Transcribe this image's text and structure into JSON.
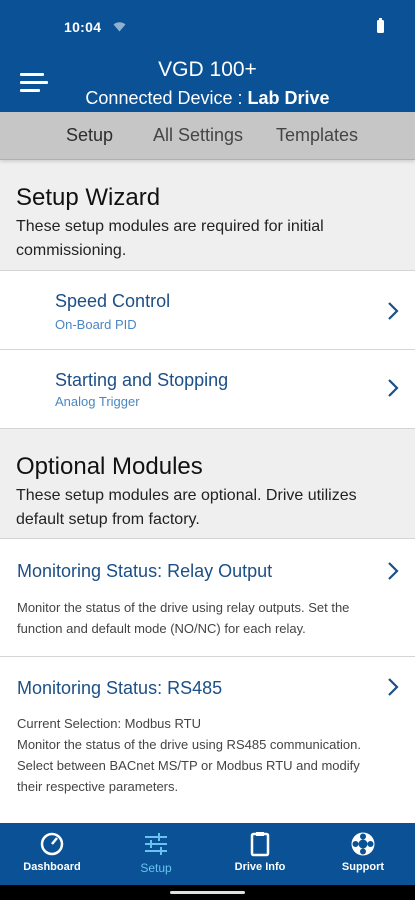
{
  "status": {
    "time": "10:04"
  },
  "header": {
    "title": "VGD 100+",
    "subtitle_prefix": "Connected Device :",
    "device_name": "Lab Drive"
  },
  "tabs": [
    {
      "label": "Setup",
      "active": true
    },
    {
      "label": "All Settings",
      "active": false
    },
    {
      "label": "Templates",
      "active": false
    }
  ],
  "setup_wizard": {
    "title": "Setup Wizard",
    "description": "These setup modules are required for initial commissioning.",
    "items": [
      {
        "title": "Speed Control",
        "subtitle": "On-Board PID"
      },
      {
        "title": "Starting and Stopping",
        "subtitle": "Analog Trigger"
      }
    ]
  },
  "optional_modules": {
    "title": "Optional Modules",
    "description": "These setup modules are optional.  Drive utilizes default setup from factory.",
    "items": [
      {
        "title": "Monitoring Status: Relay Output",
        "description": "Monitor the status of the drive using relay outputs.  Set the function and default mode (NO/NC) for each relay."
      },
      {
        "title": "Monitoring Status: RS485",
        "description": "Current Selection: Modbus RTU\nMonitor the status of the drive using RS485 communication. Select between BACnet MS/TP or Modbus RTU and modify their respective parameters."
      }
    ]
  },
  "bottom_nav": [
    {
      "label": "Dashboard",
      "icon": "speedometer-icon",
      "active": false
    },
    {
      "label": "Setup",
      "icon": "sliders-icon",
      "active": true
    },
    {
      "label": "Drive Info",
      "icon": "clipboard-icon",
      "active": false
    },
    {
      "label": "Support",
      "icon": "lifebuoy-icon",
      "active": false
    }
  ],
  "colors": {
    "header_blue": "#0a5196",
    "active_nav": "#68c3f0",
    "link_blue": "#1b4f87",
    "sub_blue": "#4a87c2",
    "tab_gray": "#c6c6c6"
  }
}
